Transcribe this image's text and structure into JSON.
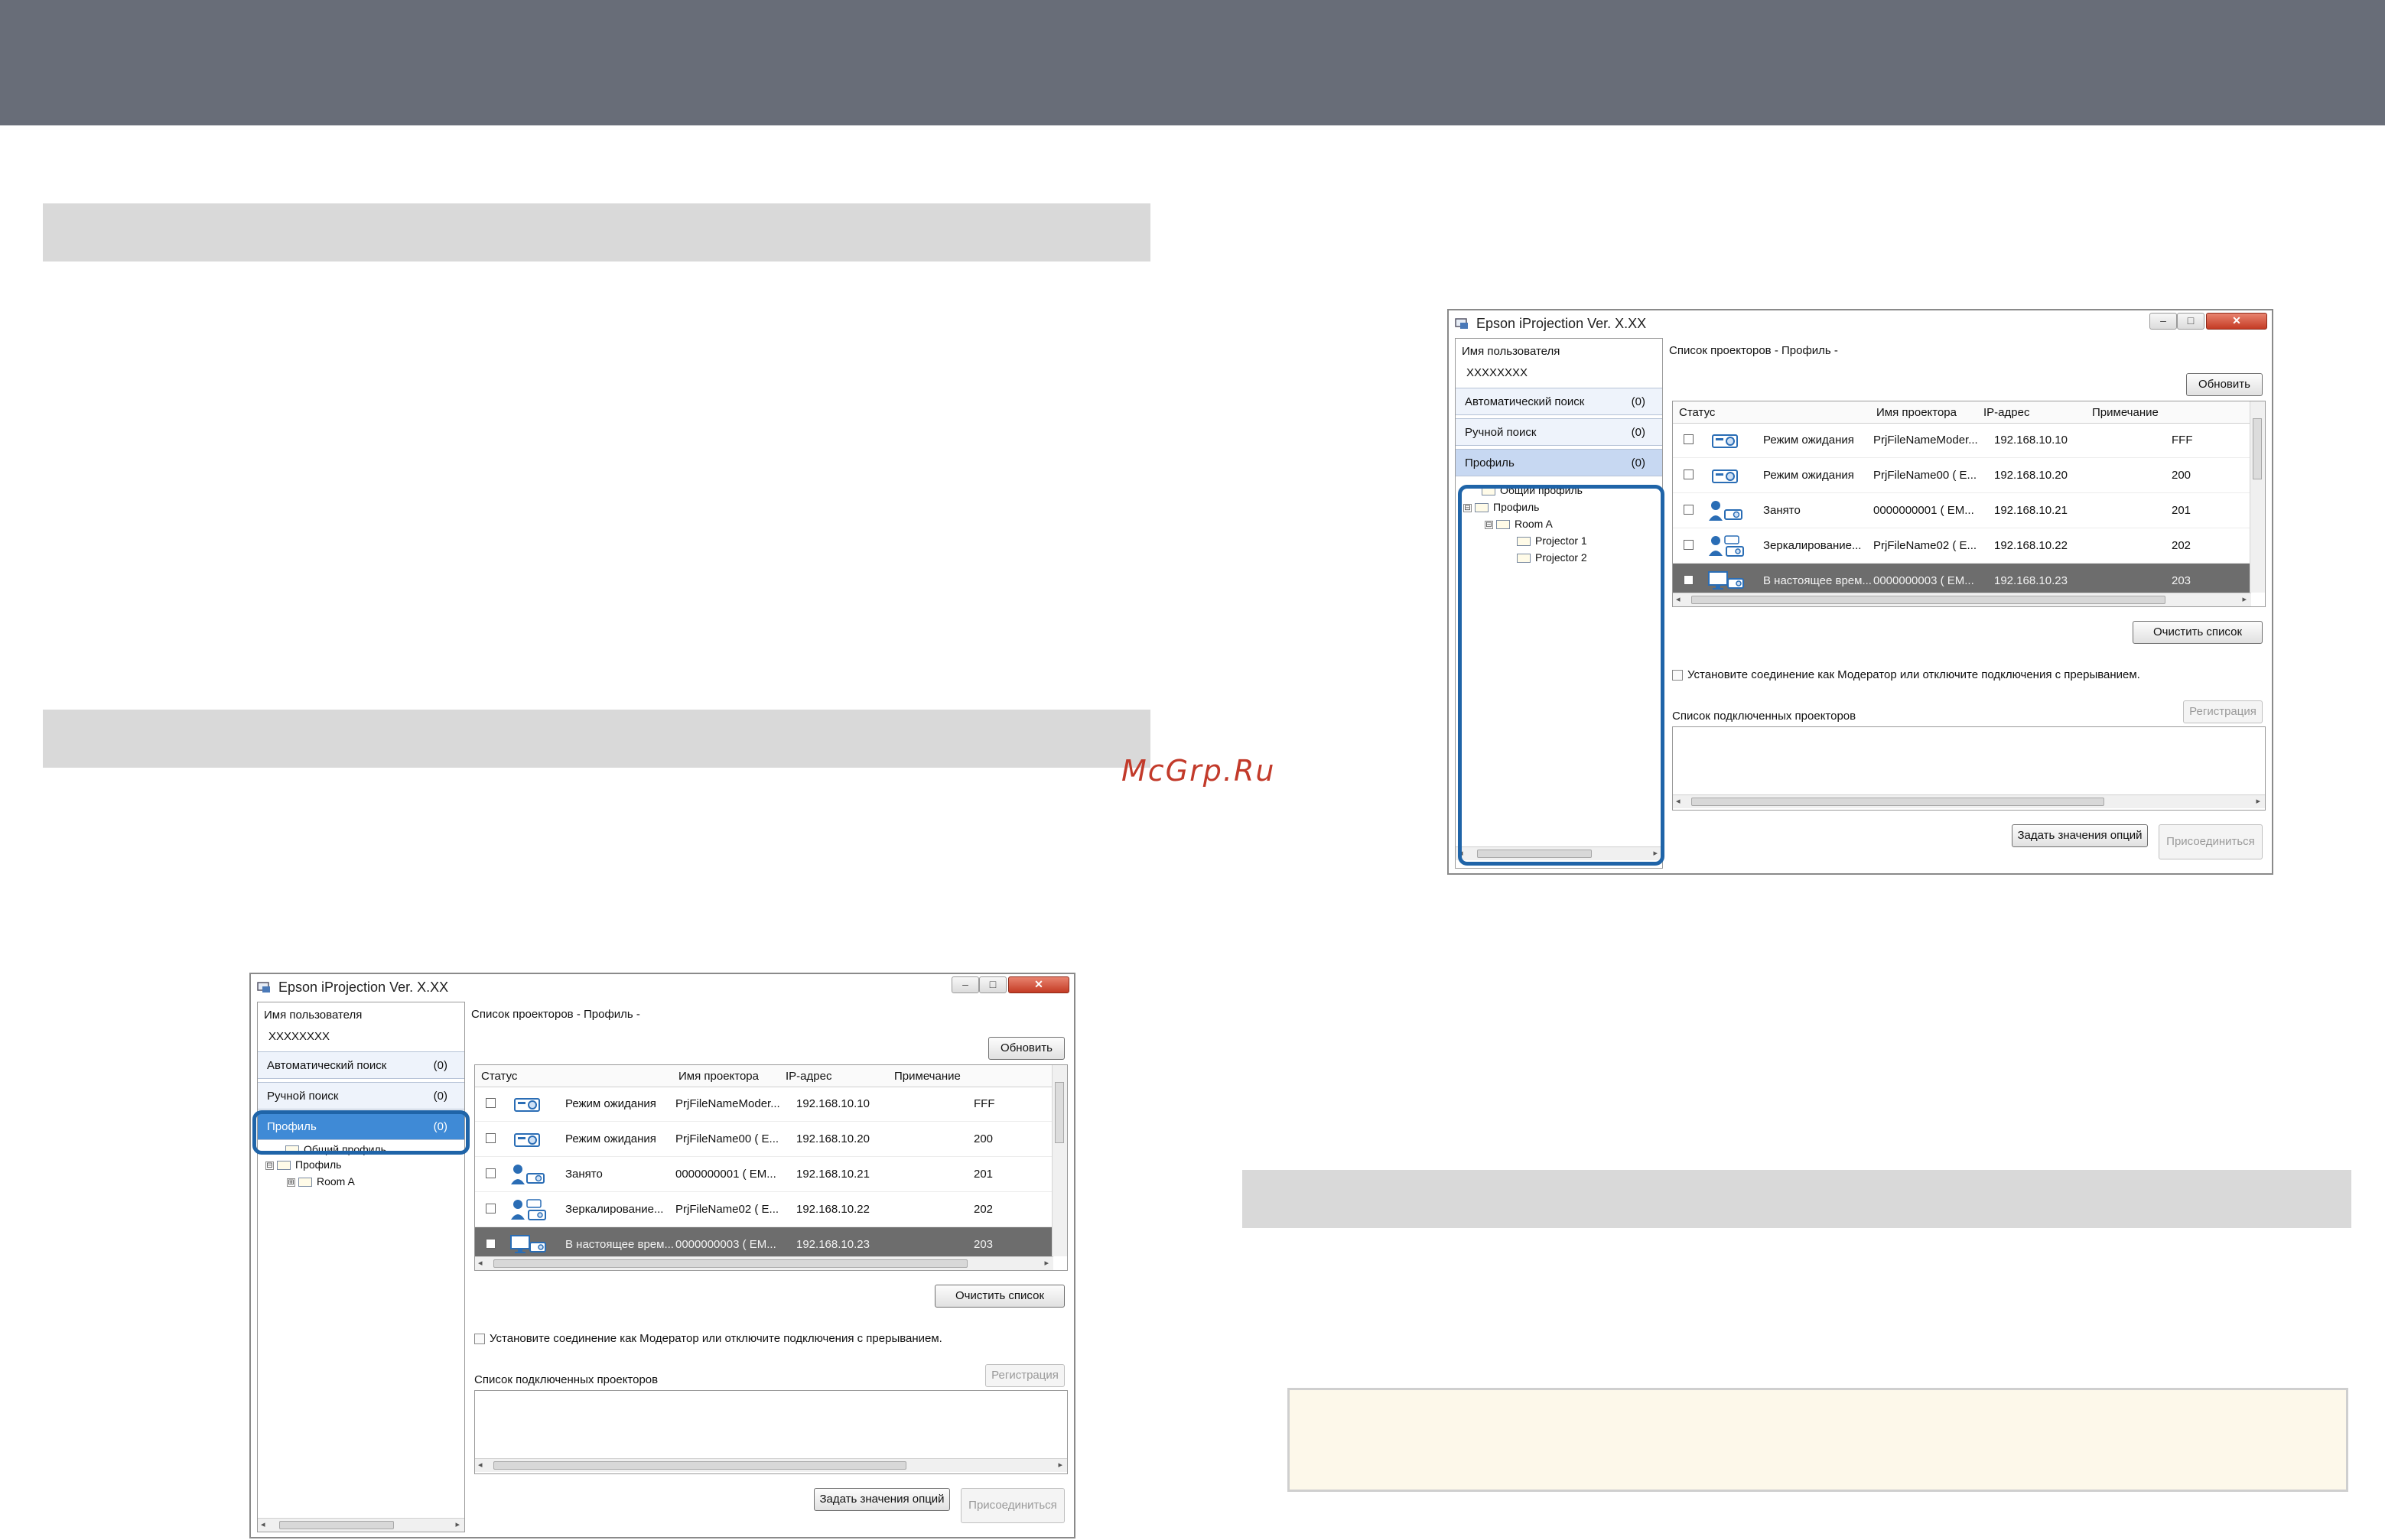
{
  "watermark": "McGrp.Ru",
  "window_left": {
    "title": "Epson iProjection Ver. X.XX",
    "user_label": "Имя пользователя",
    "user_value": "XXXXXXXX",
    "nav": [
      {
        "label": "Автоматический поиск",
        "count": "(0)"
      },
      {
        "label": "Ручной поиск",
        "count": "(0)"
      },
      {
        "label": "Профиль",
        "count": "(0)"
      }
    ],
    "tree": [
      {
        "label": "Общий профиль"
      },
      {
        "label": "Профиль",
        "expander": "⊟"
      },
      {
        "label": "Room A",
        "expander": "⊞"
      }
    ],
    "list_title": "Список проекторов - Профиль -",
    "refresh": "Обновить",
    "columns": [
      "Статус",
      "Имя проектора",
      "IP-адрес",
      "Примечание"
    ],
    "rows": [
      {
        "status": "Режим ожидания",
        "name": "PrjFileNameModer...",
        "ip": "192.168.10.10",
        "note": "FFF",
        "icon": "projector-icon"
      },
      {
        "status": "Режим ожидания",
        "name": "PrjFileName00 ( E...",
        "ip": "192.168.10.20",
        "note": "200",
        "icon": "projector-icon"
      },
      {
        "status": "Занято",
        "name": "0000000001 ( EM...",
        "ip": "192.168.10.21",
        "note": "201",
        "icon": "user-projector-icon"
      },
      {
        "status": "Зеркалирование...",
        "name": "PrjFileName02 ( E...",
        "ip": "192.168.10.22",
        "note": "202",
        "icon": "mirroring-icon"
      },
      {
        "status": "В настоящее врем...",
        "name": "0000000003 ( EM...",
        "ip": "192.168.10.23",
        "note": "203",
        "icon": "monitor-projector-icon"
      }
    ],
    "clear": "Очистить список",
    "moderator": "Установите соединение как Модератор или отключите подключения с прерыванием.",
    "connected_label": "Список подключенных проекторов",
    "register": "Регистрация",
    "options": "Задать значения опций",
    "join": "Присоединиться"
  },
  "window_right": {
    "title": "Epson iProjection Ver. X.XX",
    "user_label": "Имя пользователя",
    "user_value": "XXXXXXXX",
    "nav": [
      {
        "label": "Автоматический поиск",
        "count": "(0)"
      },
      {
        "label": "Ручной поиск",
        "count": "(0)"
      },
      {
        "label": "Профиль",
        "count": "(0)"
      }
    ],
    "tree": [
      {
        "label": "Общий профиль"
      },
      {
        "label": "Профиль",
        "expander": "⊟"
      },
      {
        "label": "Room A",
        "expander": "⊟"
      },
      {
        "label": "Projector 1"
      },
      {
        "label": "Projector 2"
      }
    ],
    "list_title": "Список проекторов - Профиль -",
    "refresh": "Обновить",
    "columns": [
      "Статус",
      "Имя проектора",
      "IP-адрес",
      "Примечание"
    ],
    "rows": [
      {
        "status": "Режим ожидания",
        "name": "PrjFileNameModer...",
        "ip": "192.168.10.10",
        "note": "FFF",
        "icon": "projector-icon"
      },
      {
        "status": "Режим ожидания",
        "name": "PrjFileName00 ( E...",
        "ip": "192.168.10.20",
        "note": "200",
        "icon": "projector-icon"
      },
      {
        "status": "Занято",
        "name": "0000000001 ( EM...",
        "ip": "192.168.10.21",
        "note": "201",
        "icon": "user-projector-icon"
      },
      {
        "status": "Зеркалирование...",
        "name": "PrjFileName02 ( E...",
        "ip": "192.168.10.22",
        "note": "202",
        "icon": "mirroring-icon"
      },
      {
        "status": "В настоящее врем...",
        "name": "0000000003 ( EM...",
        "ip": "192.168.10.23",
        "note": "203",
        "icon": "monitor-projector-icon"
      }
    ],
    "clear": "Очистить список",
    "moderator": "Установите соединение как Модератор или отключите подключения с прерыванием.",
    "connected_label": "Список подключенных проекторов",
    "register": "Регистрация",
    "options": "Задать значения опций",
    "join": "Присоединиться"
  },
  "colors": {
    "topbar": "#686d78",
    "section_bar": "#d9d9d9",
    "highlight": "#1f64a8",
    "note_box": "#fdf8ea",
    "watermark": "#c23a2a"
  }
}
